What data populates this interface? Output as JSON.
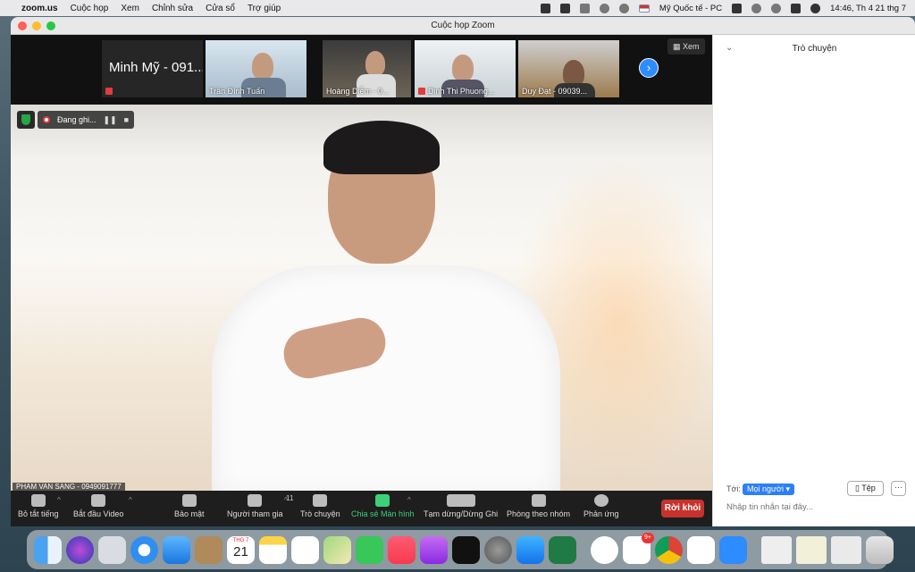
{
  "menubar": {
    "app_name": "zoom.us",
    "menus": [
      "Cuộc họp",
      "Xem",
      "Chỉnh sửa",
      "Cửa sổ",
      "Trợ giúp"
    ],
    "input_source": "Mỹ Quốc tế - PC",
    "clock": "14:46, Th 4 21 thg 7"
  },
  "window": {
    "title": "Cuộc họp Zoom"
  },
  "gallery": {
    "participants": [
      {
        "name": "Minh Mỹ - 091..."
      },
      {
        "name": "Trần Đình Tuấn"
      },
      {
        "name": "Hoàng Diễm - 0..."
      },
      {
        "name": "Dinh Thi Phuong..."
      },
      {
        "name": "Duy Đạt - 09039..."
      }
    ],
    "view_label": "Xem"
  },
  "recording": {
    "status": "Đang ghi..."
  },
  "speaker": {
    "name": "PHAM VAN SANG - 0949091777"
  },
  "toolbar": {
    "mute": "Bỏ tắt tiếng",
    "video": "Bắt đầu Video",
    "security": "Bảo mật",
    "participants": "Người tham gia",
    "participants_count": "11",
    "chat": "Trò chuyện",
    "share": "Chia sẻ Màn hình",
    "record": "Tạm dừng/Dừng Ghi",
    "breakout": "Phòng theo nhóm",
    "reactions": "Phản ứng",
    "leave": "Rời khỏi"
  },
  "chat": {
    "title": "Trò chuyện",
    "to_label": "Tới:",
    "to_value": "Mọi người ▾",
    "file_button": "Tệp",
    "more_button": "···",
    "placeholder": "Nhập tin nhắn tại đây..."
  },
  "dock": {
    "calendar_month": "THG 7",
    "calendar_day": "21",
    "zalo_badge": "9+",
    "apps": [
      "finder",
      "siri",
      "launchpad",
      "safari",
      "mail",
      "contacts",
      "calendar",
      "notes",
      "reminders",
      "maps",
      "messages",
      "music",
      "podcasts",
      "tv",
      "system-preferences",
      "app-store",
      "excel",
      "teamviewer",
      "zalo",
      "chrome",
      "powerpoint",
      "zoom",
      "preview-window-1",
      "preview-window-2",
      "preview-window-3",
      "trash"
    ]
  }
}
